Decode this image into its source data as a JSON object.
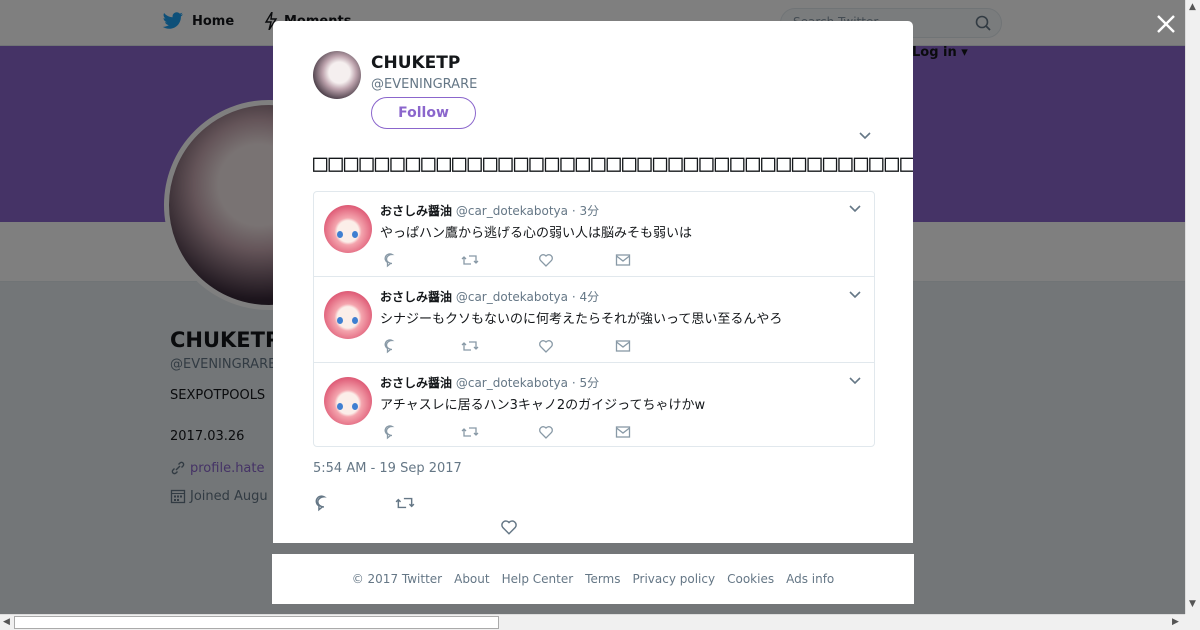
{
  "background": {
    "nav": {
      "home_label": "Home",
      "moments_label": "Moments",
      "search_placeholder": "Search Twitter",
      "login_label": "Log in"
    },
    "profile": {
      "name": "CHUKETP",
      "handle": "@EVENINGRARE",
      "bio": "SEXPOTPOOLS",
      "date": "2017.03.26",
      "link": "profile.hate",
      "joined": "Joined Augu"
    },
    "banner_color": "#8b66cc"
  },
  "modal": {
    "author": {
      "name": "CHUKETP",
      "handle": "@EVENINGRARE",
      "follow_label": "Follow"
    },
    "tweet_text": "□□□□□□□□□□□□□□□□□□□□□□□□□□□□□□□□□□□□□□□□□□□□□□□□□□□□□□□□□□□□□",
    "timestamp": "5:54 AM - 19 Sep 2017",
    "embedded_tweets": [
      {
        "name": "おさしみ醤油",
        "handle": "@car_dotekabotya",
        "time": "· 3分",
        "text": "やっぱハン鷹から逃げる心の弱い人は脳みそも弱いは"
      },
      {
        "name": "おさしみ醤油",
        "handle": "@car_dotekabotya",
        "time": "· 4分",
        "text": "シナジーもクソもないのに何考えたらそれが強いって思い至るんやろ"
      },
      {
        "name": "おさしみ醤油",
        "handle": "@car_dotekabotya",
        "time": "· 5分",
        "text": "アチャスレに居るハン3キャノ2のガイジってちゃけかw"
      }
    ]
  },
  "footer": {
    "copyright": "© 2017 Twitter",
    "links": [
      "About",
      "Help Center",
      "Terms",
      "Privacy policy",
      "Cookies",
      "Ads info"
    ]
  },
  "colors": {
    "accent": "#8b66cc",
    "twitter_blue": "#1da1f2",
    "muted": "#657786"
  }
}
